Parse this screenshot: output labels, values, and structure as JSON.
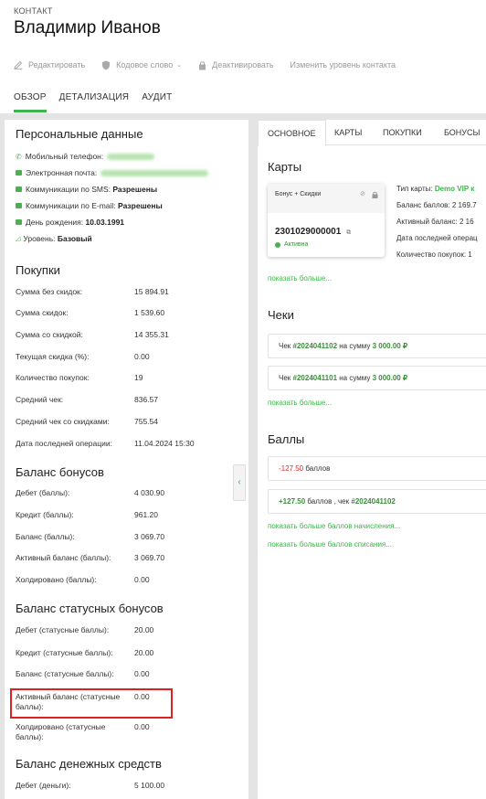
{
  "header": {
    "kicker": "КОНТАКТ",
    "title": "Владимир Иванов",
    "actions": {
      "edit": "Редактировать",
      "code_word": "Кодовое слово",
      "deactivate": "Деактивировать",
      "change_level": "Изменить уровень контакта"
    },
    "tabs": [
      "ОБЗОР",
      "ДЕТАЛИЗАЦИЯ",
      "АУДИТ"
    ]
  },
  "personal": {
    "title": "Персональные данные",
    "mobile_label": "Мобильный телефон:",
    "email_label": "Электронная почта:",
    "sms_label": "Коммуникации по SMS:",
    "sms_value": "Разрешены",
    "emailcomm_label": "Коммуникации по E-mail:",
    "emailcomm_value": "Разрешены",
    "birthday_label": "День рождения:",
    "birthday_value": "10.03.1991",
    "level_label": "Уровень:",
    "level_value": "Базовый"
  },
  "purchases": {
    "title": "Покупки",
    "rows": [
      {
        "label": "Сумма без скидок:",
        "value": "15 894.91"
      },
      {
        "label": "Сумма скидок:",
        "value": "1 539.60"
      },
      {
        "label": "Сумма со скидкой:",
        "value": "14 355.31"
      },
      {
        "label": "Текущая скидка (%):",
        "value": "0.00"
      },
      {
        "label": "Количество покупок:",
        "value": "19"
      },
      {
        "label": "Средний чек:",
        "value": "836.57"
      },
      {
        "label": "Средний чек со скидками:",
        "value": "755.54"
      },
      {
        "label": "Дата последней операции:",
        "value": "11.04.2024 15:30"
      }
    ]
  },
  "bonus_balance": {
    "title": "Баланс бонусов",
    "rows": [
      {
        "label": "Дебет (баллы):",
        "value": "4 030.90"
      },
      {
        "label": "Кредит (баллы):",
        "value": "961.20"
      },
      {
        "label": "Баланс (баллы):",
        "value": "3 069.70"
      },
      {
        "label": "Активный баланс (баллы):",
        "value": "3 069.70"
      },
      {
        "label": "Холдировано (баллы):",
        "value": "0.00"
      }
    ]
  },
  "status_balance": {
    "title": "Баланс статусных бонусов",
    "rows": [
      {
        "label": "Дебет (статусные баллы):",
        "value": "20.00"
      },
      {
        "label": "Кредит (статусные баллы):",
        "value": "20.00"
      },
      {
        "label": "Баланс (статусные баллы):",
        "value": "0.00"
      },
      {
        "label": "Активный баланс (статусные баллы):",
        "value": "0.00"
      },
      {
        "label": "Холдировано (статусные баллы):",
        "value": "0.00"
      }
    ]
  },
  "money_balance": {
    "title": "Баланс денежных средств",
    "rows": [
      {
        "label": "Дебет (деньги):",
        "value": "5 100.00"
      }
    ]
  },
  "right": {
    "tabs": [
      "ОСНОВНОЕ",
      "КАРТЫ",
      "ПОКУПКИ",
      "БОНУСЫ"
    ],
    "cards_title": "Карты",
    "card": {
      "type": "Бонус + Скидки",
      "number": "2301029000001",
      "status": "Активна"
    },
    "card_info": {
      "type_label": "Тип карты:",
      "type_value": "Demo VIP к",
      "balance": "Баланс баллов: 2 169.7",
      "active_balance": "Активный баланс: 2 16",
      "last_op": "Дата последней операц",
      "purchases_count": "Количество покупок: 1"
    },
    "show_more": "показать больше...",
    "checks_title": "Чеки",
    "checks": [
      {
        "prefix": "Чек",
        "id": "#2024041102",
        "mid": "на сумму",
        "amount": "3 000.00 ₽"
      },
      {
        "prefix": "Чек",
        "id": "#2024041101",
        "mid": "на сумму",
        "amount": "3 000.00 ₽"
      }
    ],
    "points_title": "Баллы",
    "points": [
      {
        "amount": "-127.50",
        "text": "баллов"
      },
      {
        "amount": "+127.50",
        "text": "баллов , чек",
        "check": "#2024041102"
      }
    ],
    "show_more_accruals": "показать больше баллов начисления...",
    "show_more_writeoffs": "показать больше баллов списания...",
    "colors": {
      "accent": "#3cb54a",
      "negative": "#e03030",
      "highlight": "#e02020"
    }
  }
}
